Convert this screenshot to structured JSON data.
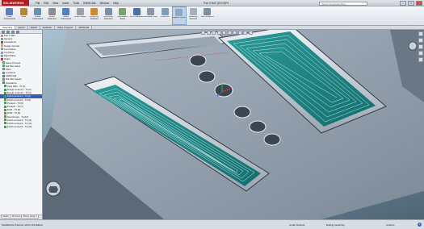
{
  "app": {
    "name": "SOLIDWORKS",
    "document_title": "Part 3 4MX (DOI 5)P4"
  },
  "menu": [
    "File",
    "Edit",
    "View",
    "Insert",
    "Tools",
    "SWMCAM",
    "Window",
    "Help"
  ],
  "search_placeholder": "Search Knowledge Base",
  "window_buttons": [
    "–",
    "□",
    "×"
  ],
  "commands": [
    {
      "label": "Insert Components",
      "icon": "insert-components-icon",
      "color": "#5b7fb8"
    },
    {
      "label": "Mate",
      "icon": "mate-icon",
      "color": "#b8863b"
    },
    {
      "label": "Linear Component",
      "icon": "linear-pattern-icon",
      "color": "#6d8fb5"
    },
    {
      "label": "Smart Fasteners",
      "icon": "smart-fasteners-icon",
      "color": "#8a8f96"
    },
    {
      "label": "Move Component",
      "icon": "move-component-icon",
      "color": "#4f80c4"
    },
    {
      "label": "Show Hidden",
      "icon": "show-hidden-icon",
      "color": "#9aa3ad"
    },
    {
      "label": "Assembly Features",
      "icon": "assembly-features-icon",
      "color": "#c48c3b"
    },
    {
      "label": "Reference Geometry",
      "icon": "reference-geometry-icon",
      "color": "#7a8fa6"
    },
    {
      "label": "New Motion Study",
      "icon": "motion-study-icon",
      "color": "#7aa36b"
    },
    {
      "label": "Bill of Materials",
      "icon": "bom-icon",
      "color": "#4d6fa8"
    },
    {
      "label": "Exploded View",
      "icon": "exploded-view-icon",
      "color": "#8896a8"
    },
    {
      "label": "Instant3D",
      "icon": "instant3d-icon",
      "color": "#7f9db8"
    },
    {
      "label": "Update Cycles",
      "icon": "update-icon",
      "color": "#8fa8c0"
    },
    {
      "label": "Assembly Sensors",
      "icon": "sensors-icon",
      "color": "#a3b0bd"
    },
    {
      "label": "Take Snapshot",
      "icon": "snapshot-icon",
      "color": "#7d8ea0"
    }
  ],
  "active_command_index": 12,
  "tabs": [
    "Assembly",
    "Layout",
    "Sketch",
    "Evaluate",
    "Office Products",
    "SWMCAM"
  ],
  "feature_tree": [
    {
      "label": "Part 3 4MX",
      "icon": "part-icon",
      "color": "#d59a2c"
    },
    {
      "label": "Sensors",
      "icon": "sensor-icon",
      "color": "#6aa0d8"
    },
    {
      "label": "Annotations",
      "icon": "annotation-icon",
      "color": "#c23a3a"
    },
    {
      "label": "Design Journal",
      "icon": "folder-icon",
      "color": "#d4a73d"
    },
    {
      "label": "Front Plane",
      "icon": "plane-icon",
      "color": "#8a9bb0"
    },
    {
      "label": "Top Plane",
      "icon": "plane-icon",
      "color": "#8a9bb0"
    },
    {
      "label": "Right Plane",
      "icon": "plane-icon",
      "color": "#8a9bb0"
    },
    {
      "label": "Origin",
      "icon": "origin-icon",
      "color": "#c23a3a"
    },
    {
      "label": "Setup Process",
      "icon": "setup-icon",
      "color": "#56a35e"
    },
    {
      "label": "Mill Part Setup",
      "icon": "mill-icon",
      "color": "#56a35e"
    },
    {
      "label": "Parts",
      "icon": "parts-icon",
      "color": "#6a8ac0"
    },
    {
      "label": "Locations",
      "icon": "location-icon",
      "color": "#6a8ac0"
    },
    {
      "label": "SWMCAM",
      "icon": "cam-icon",
      "color": "#3e7fbf"
    },
    {
      "label": "Mill Part Setup1",
      "icon": "setup-icon",
      "color": "#56a35e"
    },
    {
      "label": "Operations",
      "icon": "ops-icon",
      "color": "#3e7fbf"
    },
    {
      "label": "Face Mill1 - T1 [1]",
      "icon": "op-icon",
      "color": "#4a9a4a"
    },
    {
      "label": "Rough contour1 - T3 [2]",
      "icon": "op-icon",
      "color": "#4a9a4a"
    },
    {
      "label": "Rough contour2 - T3 [3]",
      "icon": "op-icon",
      "color": "#4a9a4a"
    },
    {
      "label": "Finish contour1 - T4 [4]",
      "icon": "op-icon",
      "color": "#4a9a4a"
    },
    {
      "label": "Finish contour2 - T4 [5]",
      "icon": "op-icon",
      "color": "#4a9a4a"
    },
    {
      "label": "Pocket1 - T5 [6]",
      "icon": "op-icon",
      "color": "#4a9a4a"
    },
    {
      "label": "Pocket2 - T5 [7]",
      "icon": "op-icon",
      "color": "#4a9a4a"
    },
    {
      "label": "Drill1 - T6 [8]",
      "icon": "drill-icon",
      "color": "#4a9a4a"
    },
    {
      "label": "Drill2 - T6 [9]",
      "icon": "drill-icon",
      "color": "#4a9a4a"
    },
    {
      "label": "Rest Rough - T3 [10]",
      "icon": "op-icon",
      "color": "#4a9a4a"
    },
    {
      "label": "Finish contour3 - T4 [11]",
      "icon": "op-icon",
      "color": "#4a9a4a"
    },
    {
      "label": "Finish contour4 - T4 [12]",
      "icon": "op-icon",
      "color": "#4a9a4a"
    },
    {
      "label": "Finish contour5 - T4 [13]",
      "icon": "op-icon",
      "color": "#4a9a4a"
    }
  ],
  "selected_tree_index": 18,
  "panel_tabs": [
    "Model",
    "3D Views",
    "Motion Study 1"
  ],
  "status": {
    "left": "SolidWorks Premium 2013 x64 Edition",
    "under_defined": "Under Defined",
    "editing": "Editing Assembly",
    "custom": "Custom"
  },
  "colors": {
    "pocket_floor": "#1f8a8a",
    "toolpath": "#d9f2f0",
    "part_surface": "#8c98a6",
    "selected_row": "#2f5fb0"
  }
}
